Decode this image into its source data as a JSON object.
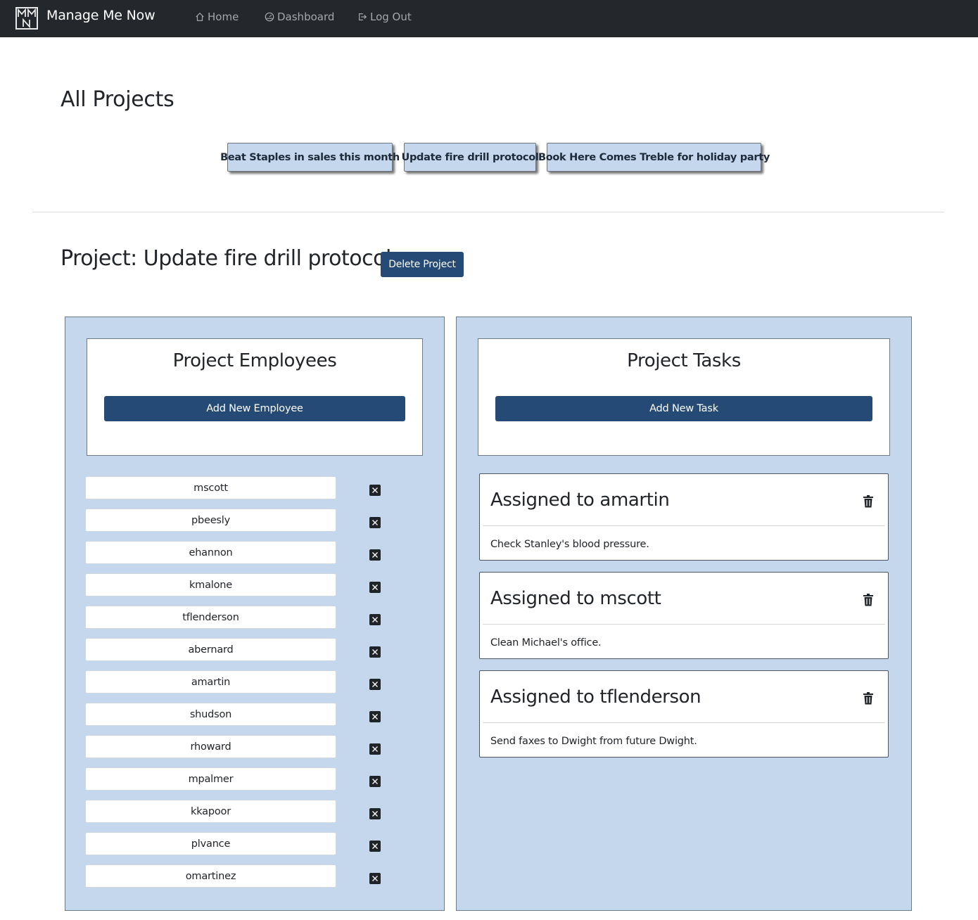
{
  "navbar": {
    "brand": "Manage Me Now",
    "links": [
      {
        "label": "Home",
        "icon": "home-icon"
      },
      {
        "label": "Dashboard",
        "icon": "dashboard-icon"
      },
      {
        "label": "Log Out",
        "icon": "logout-icon"
      }
    ]
  },
  "all_projects": {
    "title": "All Projects",
    "projects": [
      "Beat Staples in sales this month",
      "Update fire drill protocol",
      "Book Here Comes Treble for holiday party"
    ]
  },
  "project": {
    "title": "Project: Update fire drill protocol",
    "delete_label": "Delete Project"
  },
  "employees_panel": {
    "title": "Project Employees",
    "add_label": "Add New Employee",
    "employees": [
      "mscott",
      "pbeesly",
      "ehannon",
      "kmalone",
      "tflenderson",
      "abernard",
      "amartin",
      "shudson",
      "rhoward",
      "mpalmer",
      "kkapoor",
      "plvance",
      "omartinez"
    ]
  },
  "tasks_panel": {
    "title": "Project Tasks",
    "add_label": "Add New Task",
    "tasks": [
      {
        "title": "Assigned to amartin",
        "description": "Check Stanley's blood pressure."
      },
      {
        "title": "Assigned to mscott",
        "description": "Clean Michael's office."
      },
      {
        "title": "Assigned to tflenderson",
        "description": "Send faxes to Dwight from future Dwight."
      }
    ]
  },
  "colors": {
    "navbar": "#24272b",
    "panel_bg": "#c5d7ec",
    "primary_button": "#254a75"
  }
}
